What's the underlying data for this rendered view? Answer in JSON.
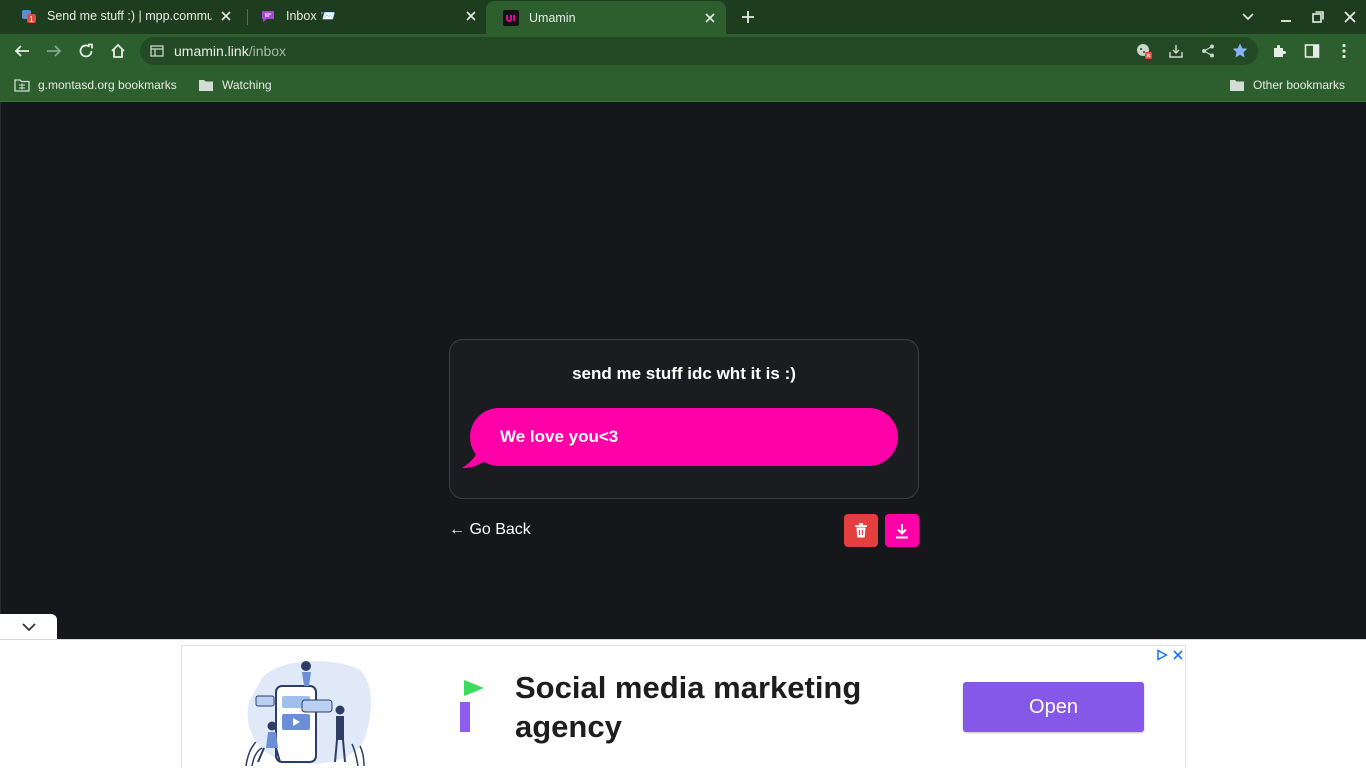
{
  "browser": {
    "tabs": [
      {
        "title": "Send me stuff :) | mpp.community",
        "active": false,
        "favicon": "mpp-favicon-with-badge",
        "badge": "1"
      },
      {
        "title": "Inbox 📨",
        "active": false,
        "favicon": "chat-bubble-favicon"
      },
      {
        "title": "Umamin",
        "active": true,
        "favicon": "umamin-logo-favicon"
      }
    ],
    "address": {
      "host": "umamin.link",
      "path": "/inbox"
    },
    "bookmarks": [
      {
        "label": "g.montasd.org bookmarks",
        "icon": "folder-grid-icon"
      },
      {
        "label": "Watching",
        "icon": "folder-icon"
      }
    ],
    "other_bookmarks": "Other bookmarks",
    "colors": {
      "tabstrip": "#1e3d1f",
      "toolbar": "#2d5e2e",
      "omnibox": "#244a25",
      "star": "#8ab4f8"
    }
  },
  "page": {
    "card_title": "send me stuff idc wht it is :)",
    "message": "We love you<3",
    "go_back": "← Go Back",
    "colors": {
      "background": "#16171b",
      "bubble": "#ff00a8",
      "delete": "#e53e3e",
      "download": "#ff00a8"
    }
  },
  "ad": {
    "headline": "Social media marketing agency",
    "cta": "Open",
    "colors": {
      "cta": "#8558e8",
      "logo_green": "#3ddc5b",
      "logo_purple": "#8f5cf0"
    }
  }
}
